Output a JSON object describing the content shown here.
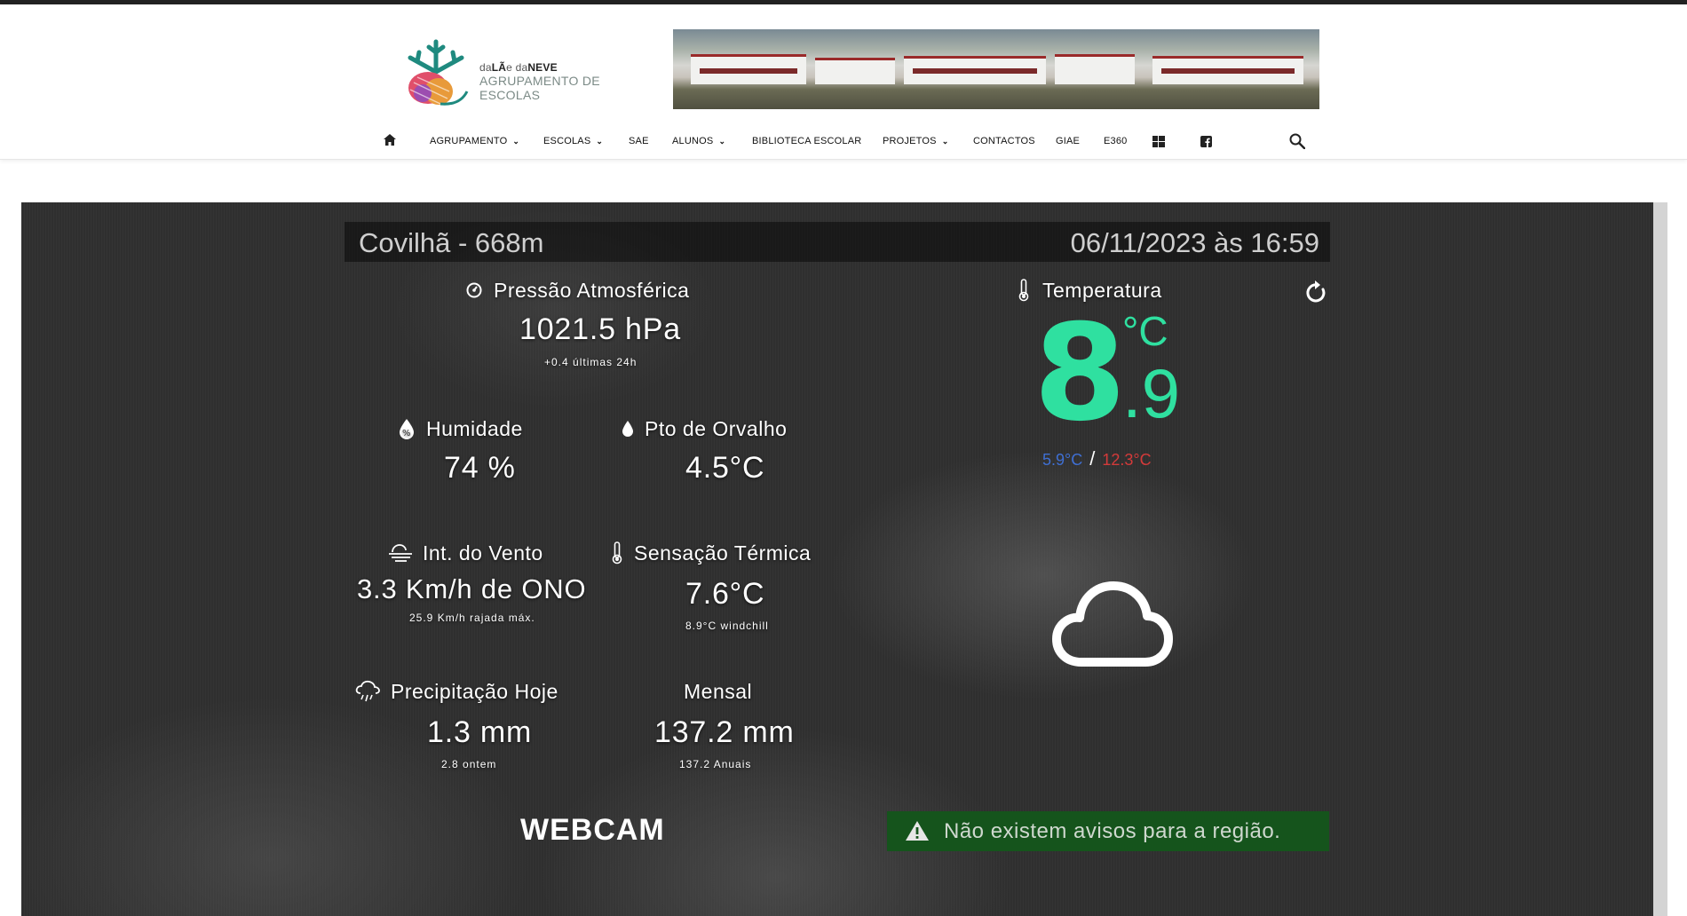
{
  "logo": {
    "line1_prefix": "da",
    "line1_la": "LÃ",
    "line1_mid": "e da",
    "line1_neve": "NEVE",
    "line2": "AGRUPAMENTO DE ESCOLAS"
  },
  "nav": {
    "items": [
      {
        "label": "AGRUPAMENTO",
        "has_dropdown": true
      },
      {
        "label": "ESCOLAS",
        "has_dropdown": true
      },
      {
        "label": "SAE",
        "has_dropdown": false
      },
      {
        "label": "ALUNOS",
        "has_dropdown": true
      },
      {
        "label": "BIBLIOTECA ESCOLAR",
        "has_dropdown": false
      },
      {
        "label": "PROJETOS",
        "has_dropdown": true
      },
      {
        "label": "CONTACTOS",
        "has_dropdown": false
      },
      {
        "label": "GIAE",
        "has_dropdown": false
      },
      {
        "label": "E360",
        "has_dropdown": false
      }
    ],
    "icons": [
      "home-icon",
      "windows-icon",
      "facebook-icon",
      "search-icon"
    ]
  },
  "station": {
    "location": "Covilhã - 668m",
    "datetime": "06/11/2023 às 16:59"
  },
  "pressure": {
    "label": "Pressão Atmosférica",
    "value": "1021.5 hPa",
    "sub": "+0.4 últimas 24h"
  },
  "humidity": {
    "label": "Humidade",
    "value": "74 %"
  },
  "dewpoint": {
    "label": "Pto de Orvalho",
    "value": "4.5°C"
  },
  "wind": {
    "label": "Int. do Vento",
    "value": "3.3 Km/h de ONO",
    "sub": "25.9 Km/h rajada máx."
  },
  "feels": {
    "label": "Sensação Térmica",
    "value": "7.6°C",
    "sub": "8.9°C windchill"
  },
  "rain": {
    "label": "Precipitação Hoje",
    "value": "1.3 mm",
    "sub": "2.8 ontem"
  },
  "monthly": {
    "label": "Mensal",
    "value": "137.2 mm",
    "sub": "137.2 Anuais"
  },
  "temperature": {
    "label": "Temperatura",
    "integer": "8",
    "unit": "°C",
    "decimal": ".9",
    "min": "5.9°C",
    "separator": "/",
    "max": "12.3°C"
  },
  "webcam_label": "WEBCAM",
  "alert_text": "Não existem avisos para a região.",
  "colors": {
    "temp_green": "#2fe0a0",
    "min_blue": "#3f6fd3",
    "max_red": "#d43a3a",
    "alert_green": "#15541c",
    "panel_dark": "#2f2f2f"
  }
}
